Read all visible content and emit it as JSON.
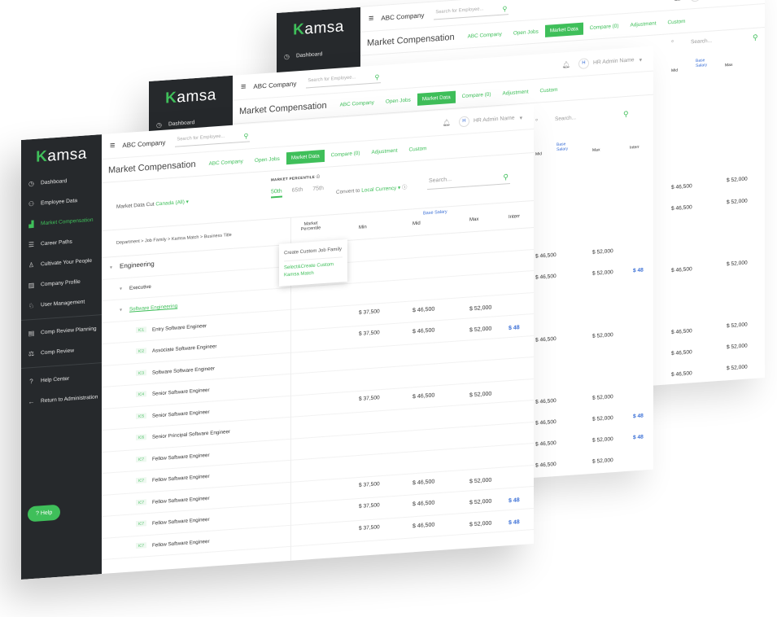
{
  "app": {
    "logo": "Kamsa",
    "company": "ABC Company",
    "search_placeholder": "Search for Employee...",
    "user": "HR Admin Name",
    "avatar": "H"
  },
  "sidebar": {
    "items": [
      {
        "label": "Dashboard",
        "icon": "dashboard-icon"
      },
      {
        "label": "Employee Data",
        "icon": "people-icon"
      },
      {
        "label": "Market Compensation",
        "icon": "bar-chart-icon",
        "active": true
      },
      {
        "label": "Career Paths",
        "icon": "list-icon"
      },
      {
        "label": "Cultivate Your People",
        "icon": "person-icon"
      },
      {
        "label": "Company Profile",
        "icon": "building-icon"
      },
      {
        "label": "User Management",
        "icon": "user-gear-icon"
      },
      {
        "label": "Comp Review Planning",
        "icon": "clipboard-icon"
      },
      {
        "label": "Comp Review",
        "icon": "review-icon"
      },
      {
        "label": "Help Center",
        "icon": "help-icon"
      },
      {
        "label": "Return to Administration",
        "icon": "arrow-left-icon"
      }
    ],
    "help_button": "Help"
  },
  "page": {
    "title": "Market Compensation",
    "tabs": [
      "ABC Company",
      "Open Jobs",
      "Market Data",
      "Compare (0)",
      "Adjustment",
      "Custom"
    ],
    "active_tab": "Market Data"
  },
  "filters": {
    "data_cut_label": "Market Data Cut",
    "data_cut_value": "Canada (All)",
    "percentile_label": "MARKET PERCENTILE",
    "percentiles": [
      "50th",
      "65th",
      "75th"
    ],
    "convert_label": "Convert to",
    "convert_value": "Local Currency",
    "search_placeholder": "Search..."
  },
  "table": {
    "breadcrumb": "Department > Job Family > Kamsa Match > Business Title",
    "market_percentile": "Market Percentile",
    "base_salary": "Base Salary",
    "columns": [
      "Min",
      "Mid",
      "Max",
      "Interr"
    ],
    "rows": [
      {
        "type": "group",
        "name": "Engineering"
      },
      {
        "type": "sub",
        "name": "Executive"
      },
      {
        "type": "sub",
        "name": "Software Engineering",
        "green": true
      },
      {
        "type": "job",
        "level": "IC1",
        "name": "Entry Software Engineer",
        "min": "$ 37,500",
        "mid": "$ 46,500",
        "max": "$ 52,000"
      },
      {
        "type": "job",
        "level": "IC2",
        "name": "Associate Software Engineer",
        "min": "$ 37,500",
        "mid": "$ 46,500",
        "max": "$ 52,000",
        "int": "$ 48"
      },
      {
        "type": "job",
        "level": "IC3",
        "name": "Software Software Engineer"
      },
      {
        "type": "job",
        "level": "IC4",
        "name": "Senior Software Engineer"
      },
      {
        "type": "job",
        "level": "IC5",
        "name": "Senior Software Engineer",
        "min": "$ 37,500",
        "mid": "$ 46,500",
        "max": "$ 52,000"
      },
      {
        "type": "job",
        "level": "IC6",
        "name": "Senior Principal Software Engineer"
      },
      {
        "type": "job",
        "level": "IC7",
        "name": "Fellow Software Engineer"
      },
      {
        "type": "job",
        "level": "IC7",
        "name": "Fellow Software Engineer"
      },
      {
        "type": "job",
        "level": "IC7",
        "name": "Fellow Software Engineer",
        "min": "$ 37,500",
        "mid": "$ 46,500",
        "max": "$ 52,000"
      },
      {
        "type": "job",
        "level": "IC7",
        "name": "Fellow Software Engineer",
        "min": "$ 37,500",
        "mid": "$ 46,500",
        "max": "$ 52,000",
        "int": "$ 48"
      },
      {
        "type": "job",
        "level": "IC7",
        "name": "Fellow Software Engineer",
        "min": "$ 37,500",
        "mid": "$ 46,500",
        "max": "$ 52,000",
        "int": "$ 48"
      }
    ]
  },
  "popup": {
    "option1": "Create Custom Job Family",
    "option2": "Select&Create Custom Kamsa Match"
  },
  "background": {
    "mid": "$ 46,500",
    "max": "$ 52,000",
    "int": "$ 48",
    "mid_label": "Mid",
    "max_label": "Max",
    "int_label": "Interr",
    "base_salary": "Base Salary",
    "search": "Search..."
  }
}
